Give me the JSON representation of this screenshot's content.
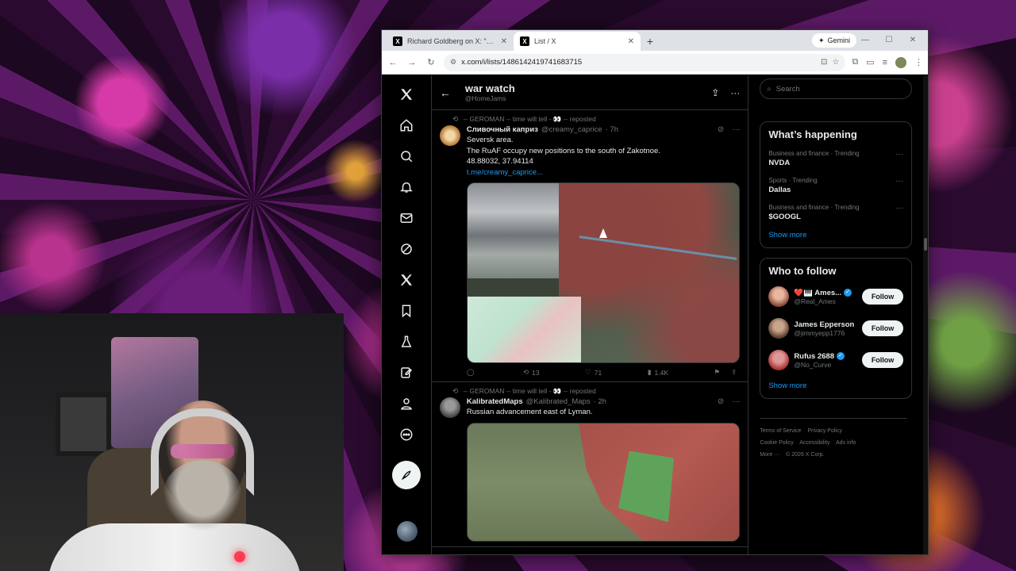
{
  "browser": {
    "tabs": [
      {
        "title": "Richard Goldberg on X: \"Now the",
        "active": false
      },
      {
        "title": "List / X",
        "active": true
      }
    ],
    "new_tab": "+",
    "gemini_label": "Gemini",
    "url": "x.com/i/lists/1486142419741683715"
  },
  "list": {
    "title": "war watch",
    "handle": "@HomeJams"
  },
  "tweets": [
    {
      "repost_text": "-- GEROMAN -- time will tell - 👀 -- reposted",
      "name": "Сливочный каприз",
      "handle": "@creamy_caprice",
      "time": "· 7h",
      "lines": [
        "Seversk area.",
        "The RuAF occupy new positions to the south of Zakotnoe.",
        "48.88032, 37.94114"
      ],
      "link": "t.me/creamy_caprice...",
      "replies": "",
      "reposts": "13",
      "likes": "71",
      "views": "1.4K"
    },
    {
      "repost_text": "-- GEROMAN -- time will tell - 👀 -- reposted",
      "name": "KalibratedMaps",
      "handle": "@Kalibrated_Maps",
      "time": "· 2h",
      "lines": [
        "Russian advancement east of Lyman."
      ]
    }
  ],
  "sidebar": {
    "search_placeholder": "Search",
    "trends_title": "What’s happening",
    "trends": [
      {
        "category": "Business and finance · Trending",
        "name": "NVDA"
      },
      {
        "category": "Sports · Trending",
        "name": "Dallas"
      },
      {
        "category": "Business and finance · Trending",
        "name": "$GOOGL"
      }
    ],
    "show_more": "Show more",
    "follow_title": "Who to follow",
    "follow": [
      {
        "name": "❤️🎹 Ames...",
        "handle": "@Real_Ames",
        "verified": true
      },
      {
        "name": "James Epperson",
        "handle": "@jimmyepp1776",
        "verified": false
      },
      {
        "name": "Rufus 2688",
        "handle": "@No_Curve",
        "verified": true
      }
    ],
    "follow_label": "Follow",
    "footer": [
      "Terms of Service",
      "Privacy Policy",
      "Cookie Policy",
      "Accessibility",
      "Ads info",
      "More ···",
      "© 2026 X Corp."
    ]
  },
  "colors": {
    "accent": "#1d9bf0",
    "background": "#000000",
    "border": "#2f3336",
    "muted": "#71767b"
  }
}
